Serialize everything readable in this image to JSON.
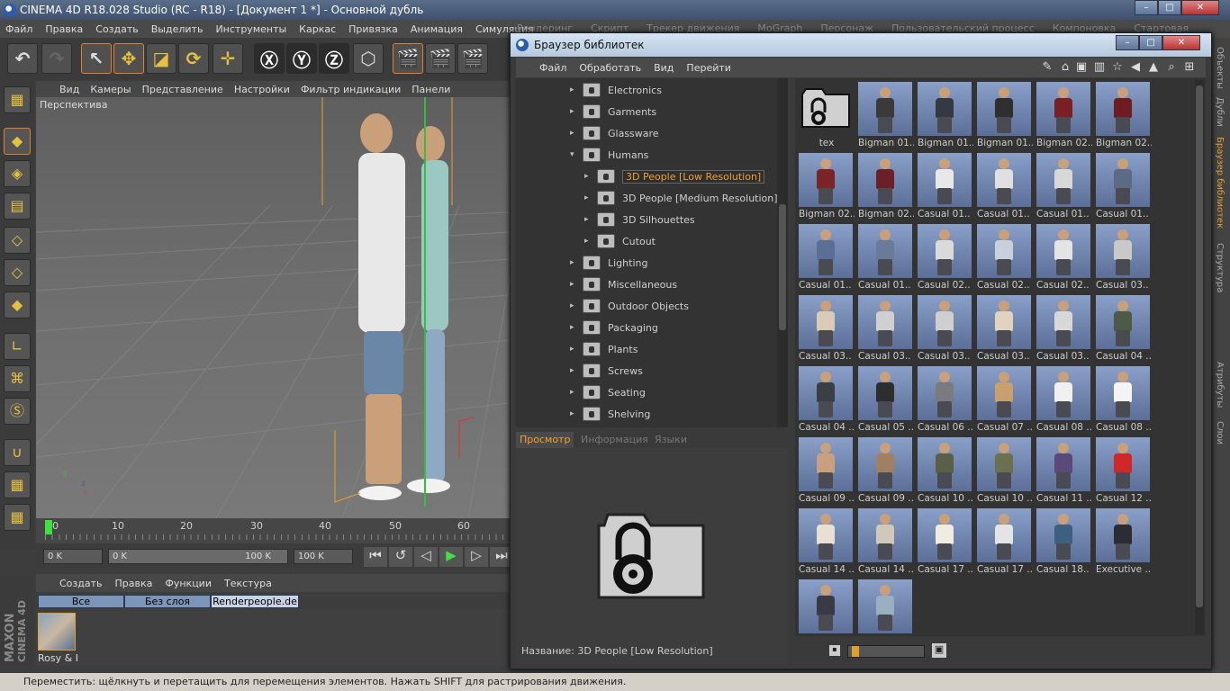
{
  "app": {
    "title": "CINEMA 4D R18.028 Studio (RC - R18) - [Документ 1 *] - Основной дубль",
    "menu": [
      "Файл",
      "Правка",
      "Создать",
      "Выделить",
      "Инструменты",
      "Каркас",
      "Привязка",
      "Анимация",
      "Симуляция"
    ],
    "menu_behind": [
      "Рендеринг",
      "Скрипт",
      "Трекер движения",
      "MoGraph",
      "Персонаж",
      "Пользовательский процесс",
      "Компоновка",
      "Стартовая"
    ],
    "viewport_menu": [
      "Вид",
      "Камеры",
      "Представление",
      "Настройки",
      "Фильтр индикации",
      "Панели"
    ],
    "viewport_label": "Перспектива",
    "timeline_ticks": [
      "0",
      "10",
      "20",
      "30",
      "40",
      "50",
      "60"
    ],
    "frame_field_1": "0 K",
    "frame_field_2": "0 K",
    "frame_field_3": "100 K",
    "frame_field_4": "100 K",
    "material_menu": [
      "Создать",
      "Правка",
      "Функции",
      "Текстура"
    ],
    "filters": [
      "Все",
      "Без слоя",
      "Renderpeople.de"
    ],
    "material_label": "Rosy & I",
    "maxon_brand": "MAXON",
    "maxon_product": "CINEMA 4D",
    "status": "Переместить: щёлкнуть и перетащить для перемещения элементов. Нажать SHIFT для растрирования движения.",
    "right_tabs": [
      "Объекты",
      "Дубли",
      "Браузер библиотек",
      "Структура",
      "Атрибуты",
      "Слои"
    ]
  },
  "library": {
    "title": "Браузер библиотек",
    "menu": [
      "Файл",
      "Обработать",
      "Вид",
      "Перейти"
    ],
    "tree": [
      {
        "label": "Electronics",
        "level": 0,
        "open": false
      },
      {
        "label": "Garments",
        "level": 0,
        "open": false
      },
      {
        "label": "Glassware",
        "level": 0,
        "open": false
      },
      {
        "label": "Humans",
        "level": 0,
        "open": true
      },
      {
        "label": "3D People [Low Resolution]",
        "level": 1,
        "open": false,
        "selected": true
      },
      {
        "label": "3D People [Medium Resolution]",
        "level": 1,
        "open": false
      },
      {
        "label": "3D Silhouettes",
        "level": 1,
        "open": false
      },
      {
        "label": "Cutout",
        "level": 1,
        "open": false
      },
      {
        "label": "Lighting",
        "level": 0,
        "open": false
      },
      {
        "label": "Miscellaneous",
        "level": 0,
        "open": false
      },
      {
        "label": "Outdoor Objects",
        "level": 0,
        "open": false
      },
      {
        "label": "Packaging",
        "level": 0,
        "open": false
      },
      {
        "label": "Plants",
        "level": 0,
        "open": false
      },
      {
        "label": "Screws",
        "level": 0,
        "open": false
      },
      {
        "label": "Seating",
        "level": 0,
        "open": false
      },
      {
        "label": "Shelving",
        "level": 0,
        "open": false
      }
    ],
    "tabs": [
      "Просмотр",
      "Информация",
      "Языки"
    ],
    "preview_name": "Название:  3D People [Low Resolution]",
    "items": [
      {
        "label": "tex",
        "kind": "folder"
      },
      {
        "label": "Bigman 01..",
        "color": "#3a3a3a"
      },
      {
        "label": "Bigman 01..",
        "color": "#333a44"
      },
      {
        "label": "Bigman 01..",
        "color": "#2f2f30"
      },
      {
        "label": "Bigman 02..",
        "color": "#7a1f24"
      },
      {
        "label": "Bigman 02..",
        "color": "#6e1c22"
      },
      {
        "label": "Bigman 02..",
        "color": "#7a2428"
      },
      {
        "label": "Bigman 02..",
        "color": "#6a2026"
      },
      {
        "label": "Casual 01..",
        "color": "#e8e8e8"
      },
      {
        "label": "Casual 01..",
        "color": "#e0e0e0"
      },
      {
        "label": "Casual 01..",
        "color": "#d8d8d8"
      },
      {
        "label": "Casual 01..",
        "color": "#5c6a86"
      },
      {
        "label": "Casual 01..",
        "color": "#5b6f95"
      },
      {
        "label": "Casual 01..",
        "color": "#6a7a9a"
      },
      {
        "label": "Casual 02..",
        "color": "#dadada"
      },
      {
        "label": "Casual 02..",
        "color": "#c8d0dc"
      },
      {
        "label": "Casual 02..",
        "color": "#e4e4e4"
      },
      {
        "label": "Casual 03..",
        "color": "#c9c9c9"
      },
      {
        "label": "Casual 03..",
        "color": "#d8ccb8"
      },
      {
        "label": "Casual 03..",
        "color": "#d0d0d0"
      },
      {
        "label": "Casual 03..",
        "color": "#cfcfcf"
      },
      {
        "label": "Casual 03..",
        "color": "#e0d4c0"
      },
      {
        "label": "Casual 03..",
        "color": "#d8d8d8"
      },
      {
        "label": "Casual 04 ..",
        "color": "#4e5a48"
      },
      {
        "label": "Casual 04 ..",
        "color": "#3a3f44"
      },
      {
        "label": "Casual 05 ..",
        "color": "#2e2e2e"
      },
      {
        "label": "Casual 06 ..",
        "color": "#7a7a80"
      },
      {
        "label": "Casual 07 ..",
        "color": "#c8a070"
      },
      {
        "label": "Casual 08 ..",
        "color": "#f0f0f0"
      },
      {
        "label": "Casual 08 ..",
        "color": "#f4f4f4"
      },
      {
        "label": "Casual 09 ..",
        "color": "#c8a080"
      },
      {
        "label": "Casual 09 ..",
        "color": "#a08060"
      },
      {
        "label": "Casual 10 ..",
        "color": "#5a6048"
      },
      {
        "label": "Casual 10 ..",
        "color": "#6a7050"
      },
      {
        "label": "Casual 11 ..",
        "color": "#5a4a7a"
      },
      {
        "label": "Casual 12 ..",
        "color": "#d02828"
      },
      {
        "label": "Casual 14 ..",
        "color": "#e8e0d0"
      },
      {
        "label": "Casual 14 ..",
        "color": "#d0c8b8"
      },
      {
        "label": "Casual 17 ..",
        "color": "#f0ece0"
      },
      {
        "label": "Casual 17 ..",
        "color": "#e4e4e4"
      },
      {
        "label": "Casual 18..",
        "color": "#3c6080"
      },
      {
        "label": "Executive ..",
        "color": "#2c2c34"
      },
      {
        "label": "",
        "color": "#3a3a44"
      },
      {
        "label": "",
        "color": "#9ab0c0"
      }
    ]
  }
}
